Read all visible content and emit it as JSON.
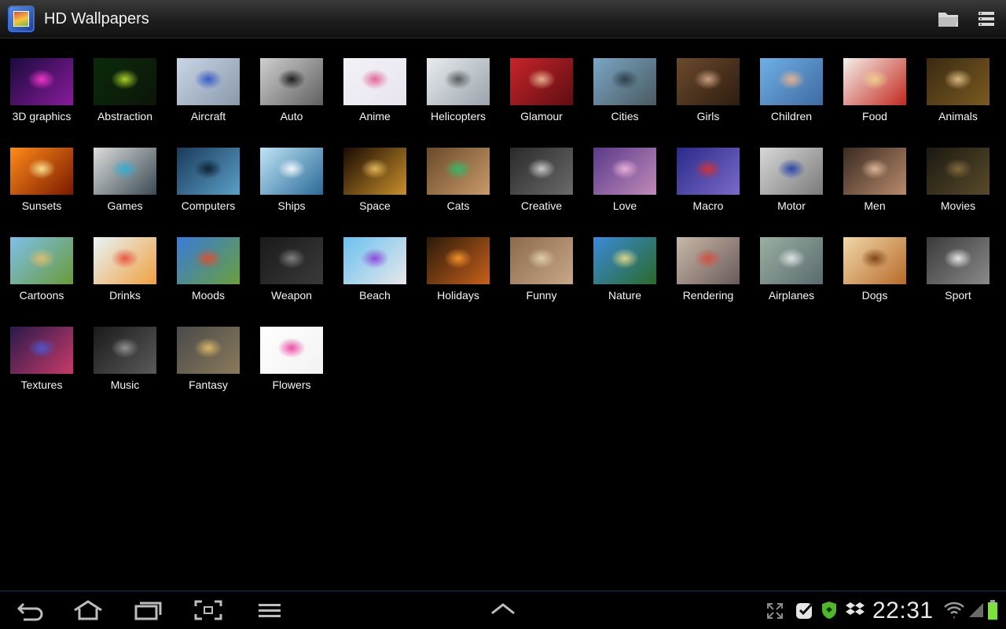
{
  "app": {
    "title": "HD Wallpapers"
  },
  "categories": [
    {
      "label": "3D graphics",
      "c1": "#1a0b3d",
      "c2": "#8a1a9c",
      "accent": "#ff3ad6"
    },
    {
      "label": "Abstraction",
      "c1": "#0b2a0a",
      "c2": "#0c160a",
      "accent": "#b6e22c"
    },
    {
      "label": "Aircraft",
      "c1": "#c8d6e6",
      "c2": "#8a98ac",
      "accent": "#2a52c8"
    },
    {
      "label": "Auto",
      "c1": "#cfcfcf",
      "c2": "#606060",
      "accent": "#111111"
    },
    {
      "label": "Anime",
      "c1": "#f2f2f6",
      "c2": "#e8e4f0",
      "accent": "#e2578f"
    },
    {
      "label": "Helicopters",
      "c1": "#e8ecef",
      "c2": "#9aa3ab",
      "accent": "#4c5150"
    },
    {
      "label": "Glamour",
      "c1": "#c7242a",
      "c2": "#5e0e12",
      "accent": "#f0c09a"
    },
    {
      "label": "Cities",
      "c1": "#7aa6c6",
      "c2": "#4a5a60",
      "accent": "#2a3844"
    },
    {
      "label": "Girls",
      "c1": "#6b4a2c",
      "c2": "#2e1d10",
      "accent": "#d6a98a"
    },
    {
      "label": "Children",
      "c1": "#6fb0e6",
      "c2": "#3f6aa2",
      "accent": "#f3b589"
    },
    {
      "label": "Food",
      "c1": "#f5f0ea",
      "c2": "#c2281e",
      "accent": "#f4d38a"
    },
    {
      "label": "Animals",
      "c1": "#3a2a12",
      "c2": "#7a5a20",
      "accent": "#e8c58a"
    },
    {
      "label": "Sunsets",
      "c1": "#ff8a1a",
      "c2": "#7a1a00",
      "accent": "#fff0a0"
    },
    {
      "label": "Games",
      "c1": "#dcdcdc",
      "c2": "#3a4a52",
      "accent": "#2bb0d8"
    },
    {
      "label": "Computers",
      "c1": "#1a3a5a",
      "c2": "#5aa0c8",
      "accent": "#0a1a2a"
    },
    {
      "label": "Ships",
      "c1": "#bfe4f6",
      "c2": "#2a6a98",
      "accent": "#ffffff"
    },
    {
      "label": "Space",
      "c1": "#1a0a02",
      "c2": "#c8902a",
      "accent": "#f0c060"
    },
    {
      "label": "Cats",
      "c1": "#6a4a2a",
      "c2": "#c89a6a",
      "accent": "#2ac06a"
    },
    {
      "label": "Creative",
      "c1": "#2a2a2a",
      "c2": "#6a6a6a",
      "accent": "#d8d8d8"
    },
    {
      "label": "Love",
      "c1": "#5a3a8a",
      "c2": "#c08ab8",
      "accent": "#f2b8e0"
    },
    {
      "label": "Macro",
      "c1": "#2a2a8a",
      "c2": "#7a6ac8",
      "accent": "#d83030"
    },
    {
      "label": "Motor",
      "c1": "#d8d8d8",
      "c2": "#7a7a7a",
      "accent": "#1a3aa8"
    },
    {
      "label": "Men",
      "c1": "#3a2a22",
      "c2": "#b88a6a",
      "accent": "#e8c0a0"
    },
    {
      "label": "Movies",
      "c1": "#1a1a12",
      "c2": "#5a4a2a",
      "accent": "#8a7040"
    },
    {
      "label": "Cartoons",
      "c1": "#7ec0e8",
      "c2": "#6a9a3a",
      "accent": "#e8c06a"
    },
    {
      "label": "Drinks",
      "c1": "#e8f4f8",
      "c2": "#f0a040",
      "accent": "#e84a3a"
    },
    {
      "label": "Moods",
      "c1": "#3a7ad8",
      "c2": "#6aa03a",
      "accent": "#e84a2a"
    },
    {
      "label": "Weapon",
      "c1": "#1a1a1a",
      "c2": "#3a3a3a",
      "accent": "#8a8a8a"
    },
    {
      "label": "Beach",
      "c1": "#6ac0f0",
      "c2": "#e8e8ea",
      "accent": "#8a3ad8"
    },
    {
      "label": "Holidays",
      "c1": "#2a1a0a",
      "c2": "#c8601a",
      "accent": "#ff9a2a"
    },
    {
      "label": "Funny",
      "c1": "#8a6a4a",
      "c2": "#c8a888",
      "accent": "#e8d4b0"
    },
    {
      "label": "Nature",
      "c1": "#3a8ad8",
      "c2": "#2a6a2a",
      "accent": "#f0e08a"
    },
    {
      "label": "Rendering",
      "c1": "#c8b8a8",
      "c2": "#6a5a5a",
      "accent": "#d84a3a"
    },
    {
      "label": "Airplanes",
      "c1": "#9ab0a0",
      "c2": "#5a6a70",
      "accent": "#e8ecef"
    },
    {
      "label": "Dogs",
      "c1": "#f0d8a8",
      "c2": "#b86a2a",
      "accent": "#7a3a10"
    },
    {
      "label": "Sport",
      "c1": "#3a3a3a",
      "c2": "#8a8a8a",
      "accent": "#f4f4f4"
    },
    {
      "label": "Textures",
      "c1": "#2a1a4a",
      "c2": "#c83a6a",
      "accent": "#4a5ad8"
    },
    {
      "label": "Music",
      "c1": "#1a1a1a",
      "c2": "#5a5a5a",
      "accent": "#9a9a9a"
    },
    {
      "label": "Fantasy",
      "c1": "#4a4a4a",
      "c2": "#8a7a5a",
      "accent": "#e8c06a"
    },
    {
      "label": "Flowers",
      "c1": "#ffffff",
      "c2": "#f2f2f2",
      "accent": "#e83a9a"
    }
  ],
  "status": {
    "time": "22:31"
  },
  "colors": {
    "battery": "#7ee03a",
    "accent_blue": "#3b6fd0"
  },
  "icons": {
    "action_bar": [
      "folder-icon",
      "list-menu-icon"
    ],
    "nav": [
      "back-icon",
      "home-icon",
      "recent-apps-icon",
      "screenshot-icon",
      "menu-icon",
      "up-chevron-icon"
    ],
    "status": [
      "expand-icon",
      "task-check-icon",
      "security-shield-icon",
      "dropbox-icon",
      "wifi-icon",
      "signal-icon",
      "battery-icon"
    ]
  }
}
